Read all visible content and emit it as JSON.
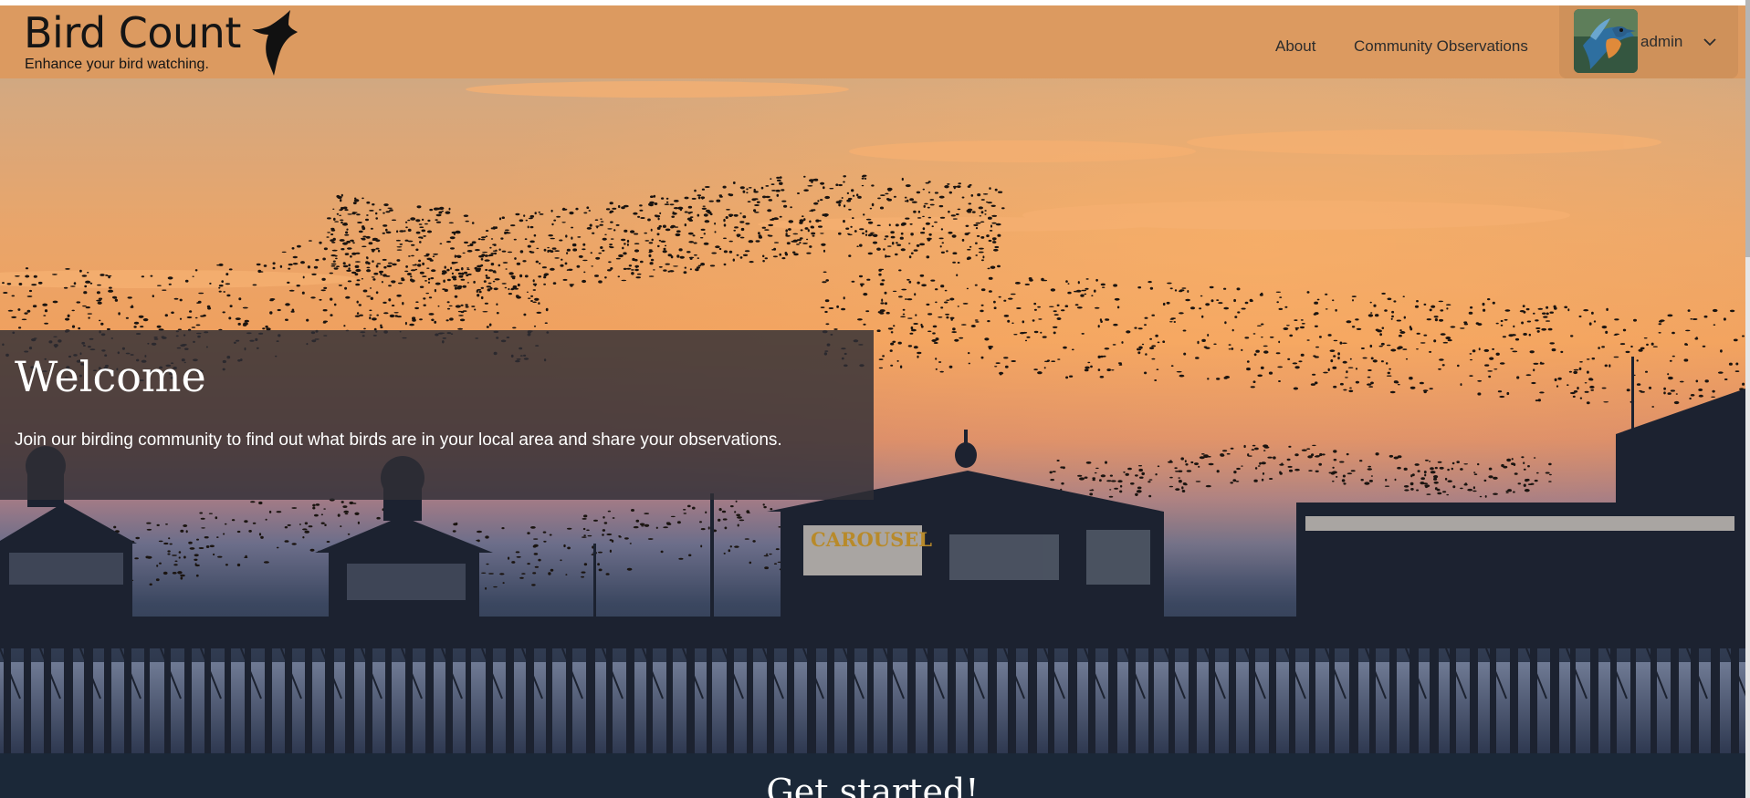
{
  "brand": {
    "title": "Bird Count",
    "tagline": "Enhance your bird watching.",
    "logo_icon": "swift-silhouette-icon"
  },
  "nav": {
    "links": [
      {
        "label": "About"
      },
      {
        "label": "Community Observations"
      }
    ],
    "user": {
      "name": "admin",
      "avatar_icon": "kingfisher-avatar",
      "menu_icon": "chevron-down-icon"
    }
  },
  "hero": {
    "image": "starling murmuration over pier at sunset",
    "sign_text": "CAROUSEL",
    "welcome": {
      "title": "Welcome",
      "text": "Join our birding community to find out what birds are in your local area and share your observations."
    }
  },
  "section": {
    "title": "Get started!"
  },
  "colors": {
    "navbar": "#dc9a60",
    "user_menu": "#cf915a",
    "welcome_panel": "#302e36",
    "footer_band": "#1b2838",
    "sky_top": "#c9a884",
    "sky_horizon": "#f0a05e"
  }
}
